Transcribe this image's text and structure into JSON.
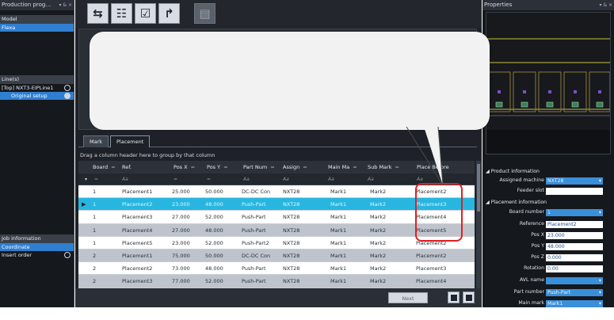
{
  "left_panel": {
    "title": "Production prog…",
    "title_controls": "▾ & ×",
    "model_header": "Model",
    "model_item": "Flexa",
    "lines_header": "Line(s)",
    "line_top": "[Top] NXT3-EIPLine1",
    "line_setup": "Original setup",
    "job_header": "Job information",
    "job_coordinate": "Coordinate",
    "job_insert_order": "Insert order"
  },
  "toolbar": {
    "icons": [
      "swap-arrows-icon",
      "grid-icon",
      "check-icon",
      "arrow-return-icon",
      "disabled-panel-icon"
    ],
    "glyphs": [
      "⇆",
      "☷",
      "☑",
      "↱",
      "▤"
    ]
  },
  "tabs": {
    "mark": "Mark",
    "placement": "Placement"
  },
  "grid": {
    "group_hint": "Drag a column header here to group by that column",
    "columns": [
      "Board",
      "Ref.",
      "Pos X",
      "Pos Y",
      "Part Num",
      "Assign",
      "Main Ma",
      "Sub Mark",
      "Place Before"
    ],
    "filter_glyph": "Aa",
    "rows": [
      [
        "1",
        "Placement1",
        "25.000",
        "50.000",
        "DC-DC Con",
        "NXT28",
        "Mark1",
        "Mark2",
        "Placement2"
      ],
      [
        "1",
        "Placement2",
        "23.000",
        "48.000",
        "Push-Part",
        "NXT28",
        "Mark1",
        "Mark2",
        "Placement3"
      ],
      [
        "1",
        "Placement3",
        "27.000",
        "52.000",
        "Push-Part",
        "NXT28",
        "Mark1",
        "Mark2",
        "Placement4"
      ],
      [
        "1",
        "Placement4",
        "27.000",
        "48.000",
        "Push-Part",
        "NXT28",
        "Mark1",
        "Mark2",
        "Placement5"
      ],
      [
        "1",
        "Placement5",
        "23.000",
        "52.000",
        "Push-Part2",
        "NXT28",
        "Mark1",
        "Mark2",
        "Placement2"
      ],
      [
        "2",
        "Placement1",
        "75.000",
        "50.000",
        "DC-DC Con",
        "NXT28",
        "Mark1",
        "Mark2",
        "Placement2"
      ],
      [
        "2",
        "Placement2",
        "73.000",
        "48.000",
        "Push-Part",
        "NXT28",
        "Mark1",
        "Mark2",
        "Placement3"
      ],
      [
        "2",
        "Placement3",
        "77.000",
        "52.000",
        "Push-Part",
        "NXT28",
        "Mark1",
        "Mark2",
        "Placement4"
      ]
    ],
    "row_styles": [
      "w",
      "s",
      "w",
      "g",
      "w",
      "g",
      "w",
      "g"
    ]
  },
  "bottom": {
    "next_label": "Next"
  },
  "right_panel": {
    "title": "Properties",
    "title_controls": "▾ & ×",
    "product_info": "Product information",
    "assigned_machine_label": "Assigned machine",
    "assigned_machine_value": "NXT28",
    "feeder_slot_label": "Feeder slot",
    "feeder_slot_value": "",
    "placement_info": "Placement information",
    "board_number_label": "Board number",
    "board_number_value": "1",
    "reference_label": "Reference",
    "reference_value": "Placement2",
    "pos_x_label": "Pos X",
    "pos_x_value": "23.000",
    "pos_y_label": "Pos Y",
    "pos_y_value": "48.000",
    "pos_z_label": "Pos Z",
    "pos_z_value": "0.000",
    "rotation_label": "Rotation",
    "rotation_value": "0.00",
    "avl_name_label": "AVL name",
    "avl_name_value": "",
    "part_number_label": "Part number",
    "part_number_value": "Push-Part",
    "main_mark_label": "Main mark",
    "main_mark_value": "Mark1"
  },
  "colors": {
    "selected_row": "#28b6e0",
    "highlight": "#e02020",
    "callout": "#f2f2f2"
  }
}
